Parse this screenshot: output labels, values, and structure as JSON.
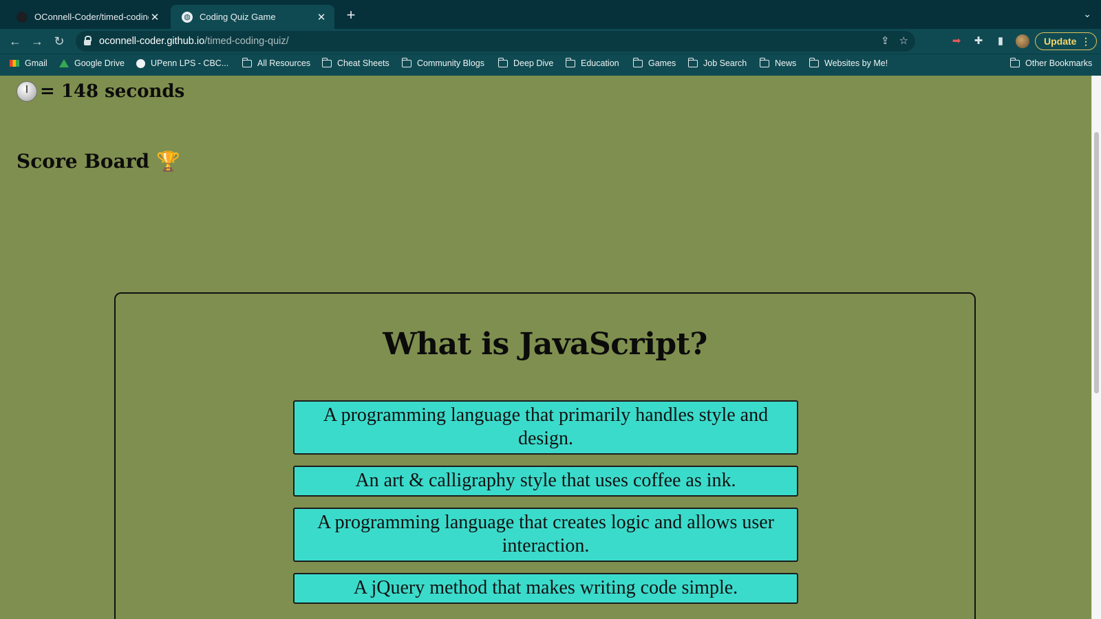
{
  "browser": {
    "tabs": [
      {
        "title": "OConnell-Coder/timed-coding-quiz",
        "active": false
      },
      {
        "title": "Coding Quiz Game",
        "active": true
      }
    ],
    "url_host": "oconnell-coder.github.io",
    "url_path": "/timed-coding-quiz/",
    "update_label": "Update",
    "bookmarks": [
      {
        "label": "Gmail",
        "icon": "gmail-icon"
      },
      {
        "label": "Google Drive",
        "icon": "google-drive-icon"
      },
      {
        "label": "UPenn LPS - CBC...",
        "icon": "globe-icon"
      },
      {
        "label": "All Resources",
        "icon": "folder-icon"
      },
      {
        "label": "Cheat Sheets",
        "icon": "folder-icon"
      },
      {
        "label": "Community Blogs",
        "icon": "folder-icon"
      },
      {
        "label": "Deep Dive",
        "icon": "folder-icon"
      },
      {
        "label": "Education",
        "icon": "folder-icon"
      },
      {
        "label": "Games",
        "icon": "folder-icon"
      },
      {
        "label": "Job Search",
        "icon": "folder-icon"
      },
      {
        "label": "News",
        "icon": "folder-icon"
      },
      {
        "label": "Websites by Me!",
        "icon": "folder-icon"
      }
    ],
    "other_bookmarks": "Other Bookmarks"
  },
  "page": {
    "timer_text": "= 148 seconds",
    "scoreboard_label": "Score Board",
    "question": "What is JavaScript?",
    "answers": [
      "A programming language that primarily handles style and design.",
      "An art & calligraphy style that uses coffee as ink.",
      "A programming language that creates logic and allows user interaction.",
      "A jQuery method that makes writing code simple."
    ],
    "colors": {
      "background": "#7f8f4f",
      "answer_button": "#3bdbcb"
    }
  }
}
